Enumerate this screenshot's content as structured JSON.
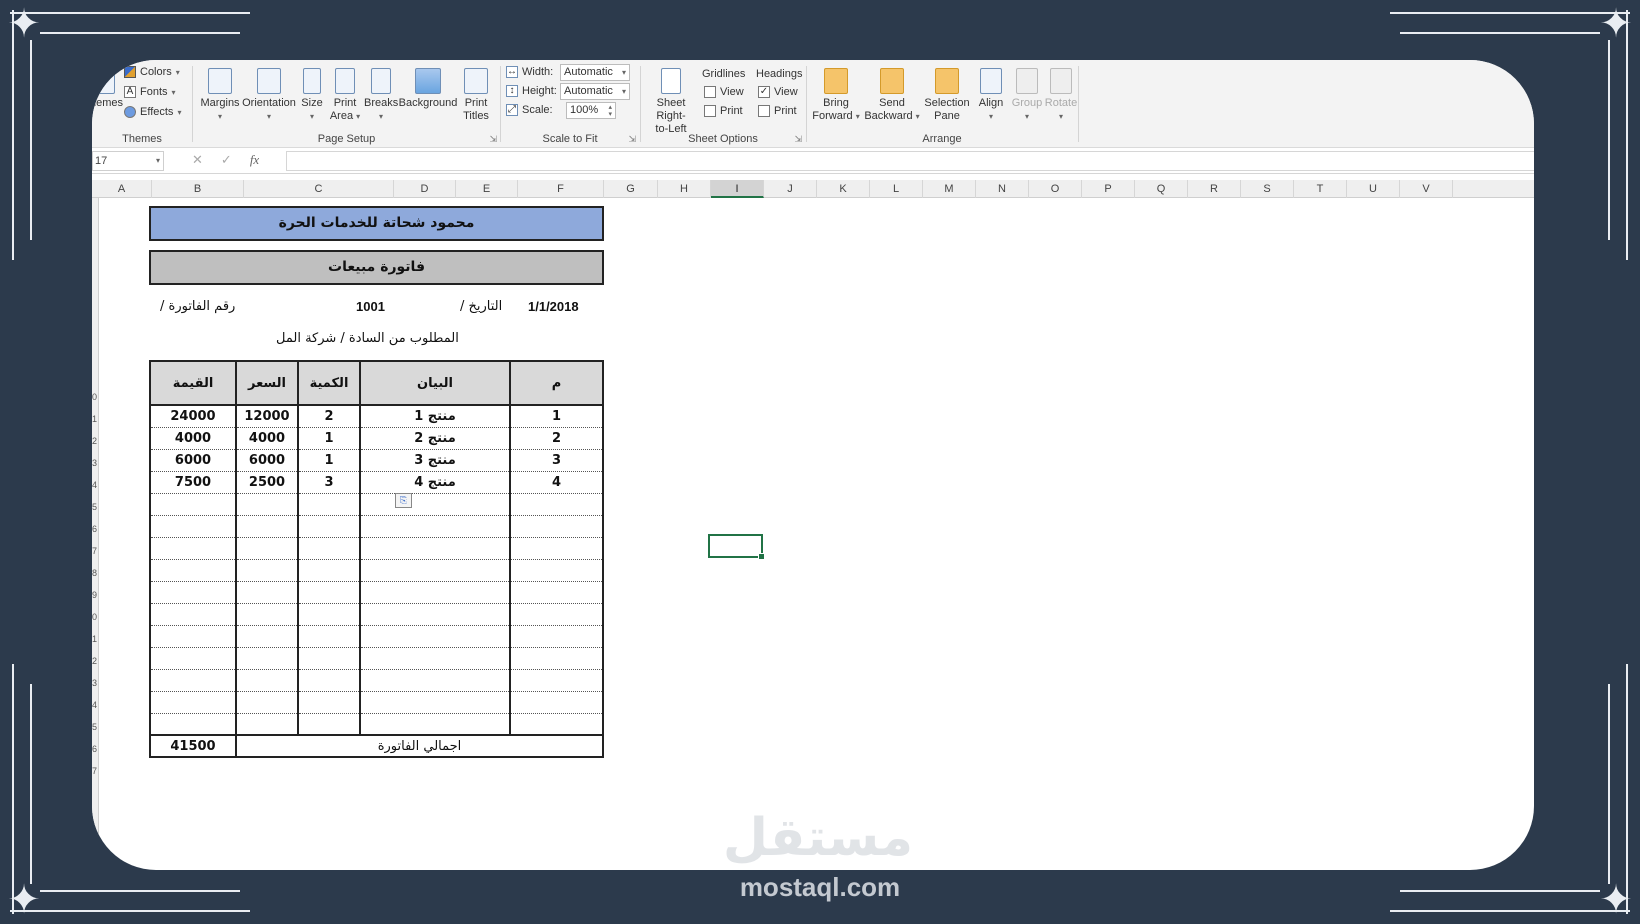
{
  "ribbon": {
    "themes": {
      "label": "Themes",
      "themes_btn": "hemes",
      "colors": "Colors",
      "fonts": "Fonts",
      "effects": "Effects"
    },
    "page_setup": {
      "label": "Page Setup",
      "margins": "Margins",
      "orientation": "Orientation",
      "size": "Size",
      "print_area_1": "Print",
      "print_area_2": "Area",
      "breaks": "Breaks",
      "background": "Background",
      "print_titles_1": "Print",
      "print_titles_2": "Titles"
    },
    "scale_to_fit": {
      "label": "Scale to Fit",
      "width_label": "Width:",
      "width_value": "Automatic",
      "height_label": "Height:",
      "height_value": "Automatic",
      "scale_label": "Scale:",
      "scale_value": "100%"
    },
    "sheet_options": {
      "label": "Sheet Options",
      "rtl_1": "Sheet Right-",
      "rtl_2": "to-Left",
      "gridlines": "Gridlines",
      "headings": "Headings",
      "view": "View",
      "print": "Print"
    },
    "arrange": {
      "label": "Arrange",
      "bring_1": "Bring",
      "bring_2": "Forward",
      "send_1": "Send",
      "send_2": "Backward",
      "selection_1": "Selection",
      "selection_2": "Pane",
      "align": "Align",
      "group": "Group",
      "rotate": "Rotate"
    }
  },
  "formula_bar": {
    "name_box": "17",
    "fx": "fx",
    "cancel": "✕",
    "enter": "✓"
  },
  "columns": [
    "A",
    "B",
    "C",
    "D",
    "E",
    "F",
    "G",
    "H",
    "I",
    "J",
    "K",
    "L",
    "M",
    "N",
    "O",
    "P",
    "Q",
    "R",
    "S",
    "T",
    "U",
    "V"
  ],
  "selected_column": "I",
  "row_numbers": [
    "0",
    "1",
    "2",
    "3",
    "4",
    "5",
    "6",
    "7",
    "8",
    "9",
    "0",
    "1",
    "2",
    "3",
    "4",
    "5",
    "6",
    "7"
  ],
  "invoice": {
    "company": "محمود شحاتة للخدمات الحرة",
    "doc_title": "فاتورة مبيعات",
    "invoice_no_label": "رقم الفاتورة /",
    "invoice_no": "1001",
    "date_label": "التاريخ /",
    "date": "1/1/2018",
    "customer": "المطلوب من السادة / شركة المل",
    "headers": [
      "م",
      "البيان",
      "الكمية",
      "السعر",
      "القيمة"
    ],
    "rows": [
      [
        "1",
        "منتج 1",
        "2",
        "12000",
        "24000"
      ],
      [
        "2",
        "منتج 2",
        "1",
        "4000",
        "4000"
      ],
      [
        "3",
        "منتج 3",
        "1",
        "6000",
        "6000"
      ],
      [
        "4",
        "منتج 4",
        "3",
        "2500",
        "7500"
      ]
    ],
    "total_label": "اجمالي الفاتورة",
    "total_value": "41500"
  },
  "watermark": {
    "arabic": "مستقل",
    "latin": "mostaql.com"
  }
}
